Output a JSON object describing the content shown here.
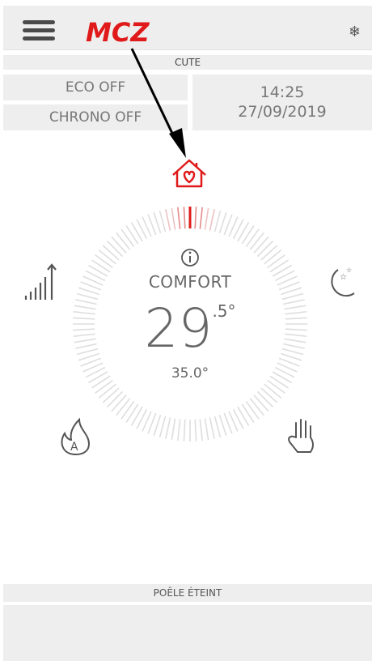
{
  "header": {
    "logo_text": "MCZ",
    "menu_icon": "hamburger-menu-icon",
    "mode_icon": "snowflake-icon"
  },
  "device": {
    "name": "CUTE"
  },
  "modes": {
    "eco": "ECO OFF",
    "chrono": "CHRONO OFF"
  },
  "clock": {
    "time": "14:25",
    "date": "27/09/2019"
  },
  "thermostat": {
    "mode_label": "COMFORT",
    "temperature_int": "29",
    "temperature_dec": ".5°",
    "setpoint": "35.0°",
    "accent_color": "#e01a1a"
  },
  "icons": {
    "top": "home-heart-icon",
    "left": "power-level-icon",
    "right": "night-moon-icon",
    "bottom_left": "auto-flame-icon",
    "bottom_right": "manual-hand-icon",
    "info": "info-icon"
  },
  "footer": {
    "status": "POÊLE ÉTEINT"
  },
  "bottom_buttons": [
    "power-button",
    "flame-button",
    "fan-button",
    "refresh-button"
  ]
}
